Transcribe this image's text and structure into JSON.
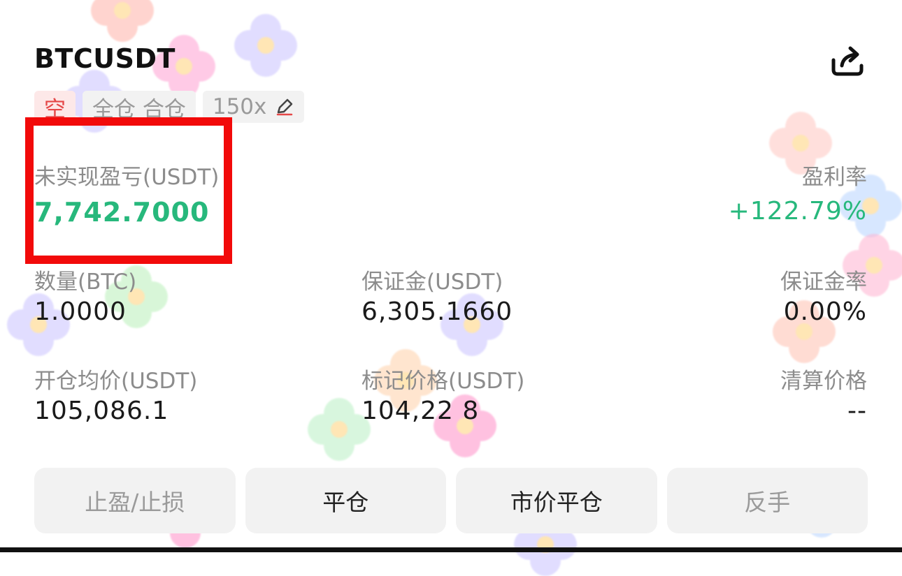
{
  "header": {
    "symbol": "BTCUSDT",
    "share_icon": "share-icon"
  },
  "tags": {
    "side": "空",
    "margin_mode": "全仓 合仓",
    "leverage": "150x",
    "edit_icon": "pencil-icon"
  },
  "pnl": {
    "label": "未实现盈亏(USDT)",
    "value": "7,742.7000",
    "rate_label": "盈利率",
    "rate_value": "+122.79%"
  },
  "stats": {
    "quantity_label": "数量(BTC)",
    "quantity_value": "1.0000",
    "margin_label": "保证金(USDT)",
    "margin_value": "6,305.1660",
    "margin_rate_label": "保证金率",
    "margin_rate_value": "0.00%",
    "entry_label": "开仓均价(USDT)",
    "entry_value": "105,086.1",
    "mark_label": "标记价格(USDT)",
    "mark_value": "104,22 8",
    "liq_label": "清算价格",
    "liq_value": "--"
  },
  "actions": {
    "tp_sl": "止盈/止损",
    "close": "平仓",
    "market_close": "市价平仓",
    "reverse": "反手"
  },
  "colors": {
    "profit": "#27b87c",
    "short": "#e54848",
    "highlight": "#f20a0a"
  }
}
